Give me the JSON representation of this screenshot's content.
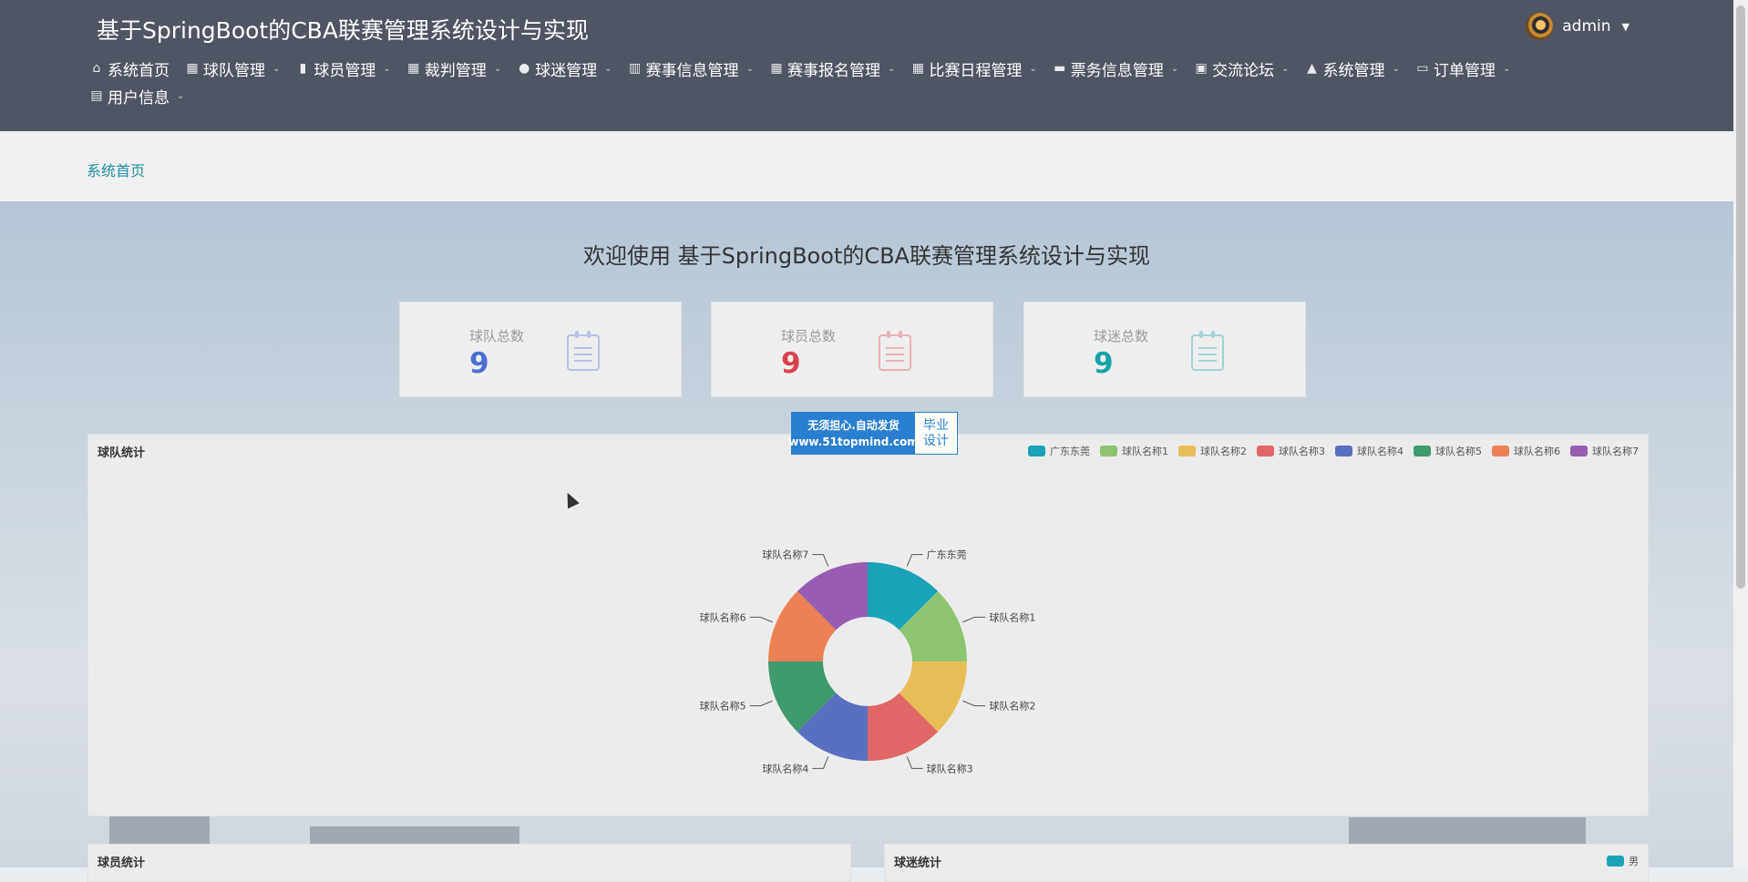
{
  "header": {
    "title": "基于SpringBoot的CBA联赛管理系统设计与实现",
    "user": "admin"
  },
  "nav": [
    {
      "label": "系统首页",
      "icon": "home-icon",
      "glyph": "⌂",
      "has_menu": false
    },
    {
      "label": "球队管理",
      "icon": "grid-icon",
      "glyph": "▦",
      "has_menu": true
    },
    {
      "label": "球员管理",
      "icon": "book-icon",
      "glyph": "▮",
      "has_menu": true
    },
    {
      "label": "裁判管理",
      "icon": "grid-icon",
      "glyph": "▦",
      "has_menu": true
    },
    {
      "label": "球迷管理",
      "icon": "user-icon",
      "glyph": "●",
      "has_menu": true
    },
    {
      "label": "赛事信息管理",
      "icon": "bar-chart-icon",
      "glyph": "▥",
      "has_menu": true
    },
    {
      "label": "赛事报名管理",
      "icon": "grid-icon",
      "glyph": "▦",
      "has_menu": true
    },
    {
      "label": "比赛日程管理",
      "icon": "grid-icon",
      "glyph": "▦",
      "has_menu": true
    },
    {
      "label": "票务信息管理",
      "icon": "ticket-icon",
      "glyph": "▬",
      "has_menu": true
    },
    {
      "label": "交流论坛",
      "icon": "print-icon",
      "glyph": "▣",
      "has_menu": true
    },
    {
      "label": "系统管理",
      "icon": "settings-icon",
      "glyph": "▲",
      "has_menu": true
    },
    {
      "label": "订单管理",
      "icon": "monitor-icon",
      "glyph": "▭",
      "has_menu": true
    },
    {
      "label": "用户信息",
      "icon": "card-icon",
      "glyph": "▤",
      "has_menu": true
    }
  ],
  "breadcrumb": "系统首页",
  "welcome": "欢迎使用 基于SpringBoot的CBA联赛管理系统设计与实现",
  "stats": [
    {
      "label": "球队总数",
      "value": "9",
      "color": "#4a6fd1"
    },
    {
      "label": "球员总数",
      "value": "9",
      "color": "#d9434f"
    },
    {
      "label": "球迷总数",
      "value": "9",
      "color": "#17a2a8"
    }
  ],
  "ad": {
    "line1": "无须担心.自动发货",
    "line2": "www.51topmind.com",
    "right1": "毕业",
    "right2": "设计"
  },
  "panels": {
    "team_chart_title": "球队统计",
    "player_chart_title": "球员统计",
    "fan_chart_title": "球迷统计",
    "fan_legend": "男"
  },
  "chart_data": {
    "type": "pie",
    "title": "球队统计",
    "categories": [
      "广东东莞",
      "球队名称1",
      "球队名称2",
      "球队名称3",
      "球队名称4",
      "球队名称5",
      "球队名称6",
      "球队名称7"
    ],
    "values": [
      1,
      1,
      1,
      1,
      1,
      1,
      1,
      1
    ],
    "colors": [
      "#1aa3b8",
      "#8dc46f",
      "#e9bd56",
      "#e06767",
      "#5b6fc0",
      "#3f9a6e",
      "#ec8154",
      "#965db3"
    ],
    "legend": "top-right",
    "donut": true
  }
}
